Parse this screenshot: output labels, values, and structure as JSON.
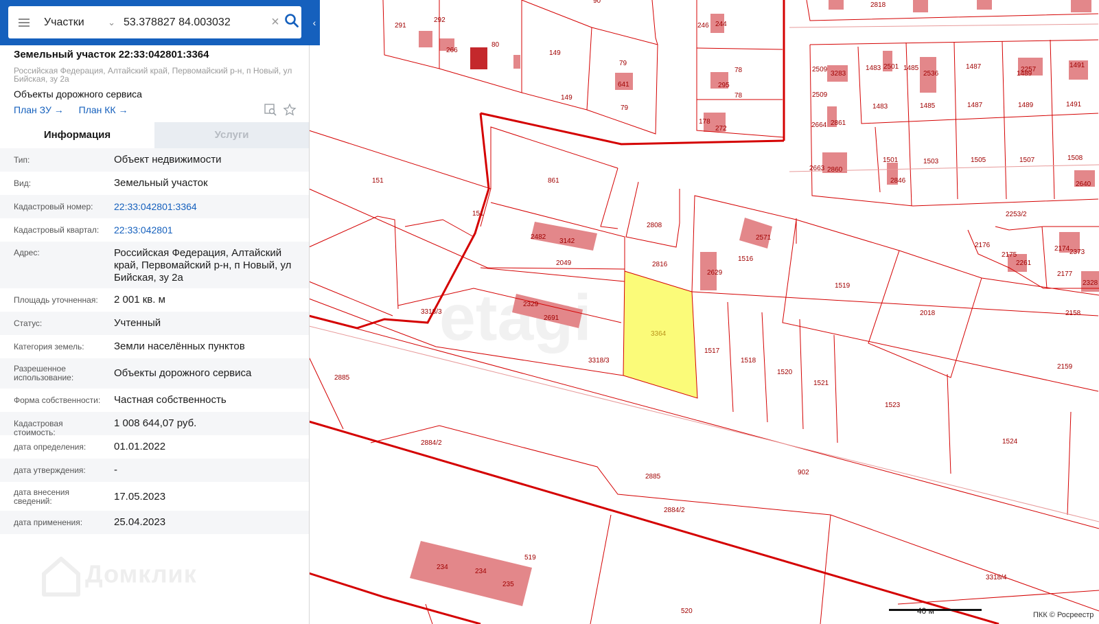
{
  "search": {
    "type_label": "Участки",
    "query": "53.378827 84.003032"
  },
  "panel": {
    "title": "Земельный участок 22:33:042801:3364",
    "address": "Российская Федерация, Алтайский край, Первомайский р-н, п Новый, ул Бийская, зу 2а",
    "purpose": "Объекты дорожного сервиса",
    "link_plan_zu": "План ЗУ →",
    "link_plan_kk": "План КК →",
    "tab_info": "Информация",
    "tab_services": "Услуги"
  },
  "info_rows": [
    {
      "label": "Тип:",
      "value": "Объект недвижимости",
      "link": false
    },
    {
      "label": "Вид:",
      "value": "Земельный участок",
      "link": false
    },
    {
      "label": "Кадастровый номер:",
      "value": "22:33:042801:3364",
      "link": true
    },
    {
      "label": "Кадастровый квартал:",
      "value": "22:33:042801",
      "link": true
    },
    {
      "label": "Адрес:",
      "value": "Российская Федерация, Алтайский край, Первомайский р-н, п Новый, ул Бийская, зу 2а",
      "link": false
    },
    {
      "label": "Площадь уточненная:",
      "value": "2 001 кв. м",
      "link": false
    },
    {
      "label": "Статус:",
      "value": "Учтенный",
      "link": false
    },
    {
      "label": "Категория земель:",
      "value": "Земли населённых пунктов",
      "link": false
    },
    {
      "label": "Разрешенное использование:",
      "value": "Объекты дорожного сервиса",
      "link": false
    },
    {
      "label": "Форма собственности:",
      "value": "Частная собственность",
      "link": false
    },
    {
      "label": "Кадастровая стоимость:",
      "value": "1 008 644,07 руб.",
      "link": false
    },
    {
      "label": "дата определения:",
      "value": "01.01.2022",
      "link": false
    },
    {
      "label": "дата утверждения:",
      "value": "-",
      "link": false
    },
    {
      "label": "дата внесения сведений:",
      "value": "17.05.2023",
      "link": false
    },
    {
      "label": "дата применения:",
      "value": "25.04.2023",
      "link": false
    }
  ],
  "watermark": "Домклик",
  "map": {
    "scale_label": "40 м",
    "attribution": "ПКК © Росреестр",
    "selected_parcel": "3364",
    "colors": {
      "line": "#d40000",
      "building": "#e3878a",
      "building_dark": "#c4282c",
      "selected": "#fbfb79",
      "label": "#a00000"
    },
    "labels": [
      {
        "t": "291"
      },
      {
        "t": "292"
      },
      {
        "t": "266"
      },
      {
        "t": "80"
      },
      {
        "t": "90"
      },
      {
        "t": "149"
      },
      {
        "t": "149"
      },
      {
        "t": "79"
      },
      {
        "t": "641"
      },
      {
        "t": "79"
      },
      {
        "t": "246"
      },
      {
        "t": "244"
      },
      {
        "t": "78"
      },
      {
        "t": "295"
      },
      {
        "t": "78"
      },
      {
        "t": "178"
      },
      {
        "t": "272"
      },
      {
        "t": "2818"
      },
      {
        "t": "2509"
      },
      {
        "t": "3283"
      },
      {
        "t": "1483"
      },
      {
        "t": "2501"
      },
      {
        "t": "1485"
      },
      {
        "t": "2536"
      },
      {
        "t": "1487"
      },
      {
        "t": "1489"
      },
      {
        "t": "2257"
      },
      {
        "t": "1491"
      },
      {
        "t": "2509"
      },
      {
        "t": "1483"
      },
      {
        "t": "1485"
      },
      {
        "t": "1487"
      },
      {
        "t": "1489"
      },
      {
        "t": "1491"
      },
      {
        "t": "2664"
      },
      {
        "t": "2861"
      },
      {
        "t": "2663"
      },
      {
        "t": "2860"
      },
      {
        "t": "1501"
      },
      {
        "t": "2846"
      },
      {
        "t": "1503"
      },
      {
        "t": "1505"
      },
      {
        "t": "1507"
      },
      {
        "t": "1508"
      },
      {
        "t": "2640"
      },
      {
        "t": "2253/2"
      },
      {
        "t": "151"
      },
      {
        "t": "861"
      },
      {
        "t": "151"
      },
      {
        "t": "2808"
      },
      {
        "t": "2482"
      },
      {
        "t": "3142"
      },
      {
        "t": "2049"
      },
      {
        "t": "2816"
      },
      {
        "t": "2629"
      },
      {
        "t": "1516"
      },
      {
        "t": "2571"
      },
      {
        "t": "1519"
      },
      {
        "t": "2176"
      },
      {
        "t": "2175"
      },
      {
        "t": "2261"
      },
      {
        "t": "2174"
      },
      {
        "t": "2373"
      },
      {
        "t": "2177"
      },
      {
        "t": "2328"
      },
      {
        "t": "2018"
      },
      {
        "t": "2158"
      },
      {
        "t": "3318/3"
      },
      {
        "t": "2329"
      },
      {
        "t": "2691"
      },
      {
        "t": "3364"
      },
      {
        "t": "1517"
      },
      {
        "t": "1518"
      },
      {
        "t": "1520"
      },
      {
        "t": "1521"
      },
      {
        "t": "3318/3"
      },
      {
        "t": "2159"
      },
      {
        "t": "2885"
      },
      {
        "t": "1523"
      },
      {
        "t": "2884/2"
      },
      {
        "t": "1524"
      },
      {
        "t": "902"
      },
      {
        "t": "2885"
      },
      {
        "t": "2884/2"
      },
      {
        "t": "519"
      },
      {
        "t": "234"
      },
      {
        "t": "234"
      },
      {
        "t": "235"
      },
      {
        "t": "3318/4"
      },
      {
        "t": "520"
      }
    ]
  }
}
